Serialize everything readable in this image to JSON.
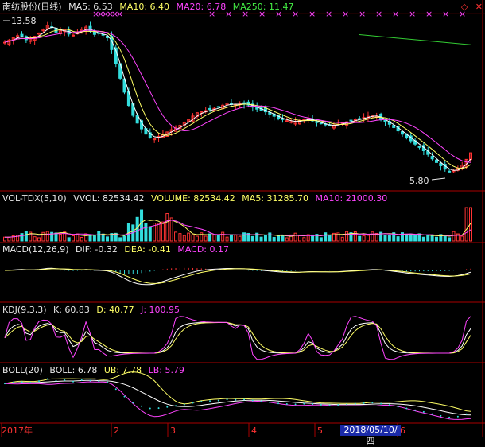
{
  "main": {
    "title": "南纺股份(日线)",
    "ma5": "MA5: 6.53",
    "ma10": "MA10: 6.40",
    "ma20": "MA20: 6.78",
    "ma250": "MA250: 11.47",
    "price_high_label": "13.58",
    "price_low_label": "5.80",
    "icons": [
      "diamond-icon",
      "close-icon"
    ]
  },
  "vol": {
    "title": "VOL-TDX(5,10)",
    "vvol": "VVOL: 82534.42",
    "volume": "VOLUME: 82534.42",
    "ma5": "MA5: 31285.70",
    "ma10": "MA10: 21000.30"
  },
  "macd": {
    "title": "MACD(12,26,9)",
    "dif": "DIF: -0.32",
    "dea": "DEA: -0.41",
    "macd": "MACD: 0.17"
  },
  "kdj": {
    "title": "KDJ(9,3,3)",
    "k": "K: 60.83",
    "d": "D: 40.77",
    "j": "J: 100.95"
  },
  "boll": {
    "title": "BOLL(20)",
    "boll": "BOLL: 6.78",
    "ub": "UB: 7.78",
    "lb": "LB: 5.79"
  },
  "axis": {
    "labels": [
      "2017年",
      "2",
      "3",
      "4",
      "5",
      "6"
    ],
    "cursor_date": "2018/05/10/四"
  },
  "colors": {
    "up": "#ff3333",
    "down": "#33dddd",
    "ma5": "#ffffff",
    "ma10": "#ffff66",
    "ma20": "#ff44ff",
    "ma250": "#33cc33",
    "grid": "#aa0000"
  },
  "chart_data": {
    "type": "candlestick",
    "close_path": [
      12.6,
      12.8,
      13.0,
      12.7,
      12.9,
      13.2,
      13.58,
      13.1,
      13.3,
      12.9,
      13.2,
      13.4,
      13.0,
      13.1,
      12.8,
      11.5,
      10.2,
      9.0,
      8.3,
      7.8,
      7.5,
      7.7,
      7.9,
      8.1,
      8.3,
      8.6,
      8.9,
      9.0,
      9.1,
      9.2,
      9.4,
      9.3,
      9.4,
      9.3,
      9.1,
      9.0,
      8.8,
      8.6,
      8.5,
      8.4,
      8.5,
      8.6,
      8.4,
      8.3,
      8.2,
      8.3,
      8.4,
      8.5,
      8.6,
      8.7,
      8.8,
      8.5,
      8.3,
      8.0,
      7.7,
      7.4,
      7.1,
      6.8,
      6.4,
      6.1,
      5.8,
      5.9,
      6.2,
      6.8
    ],
    "ma250_path": [
      11.8,
      11.47
    ]
  }
}
